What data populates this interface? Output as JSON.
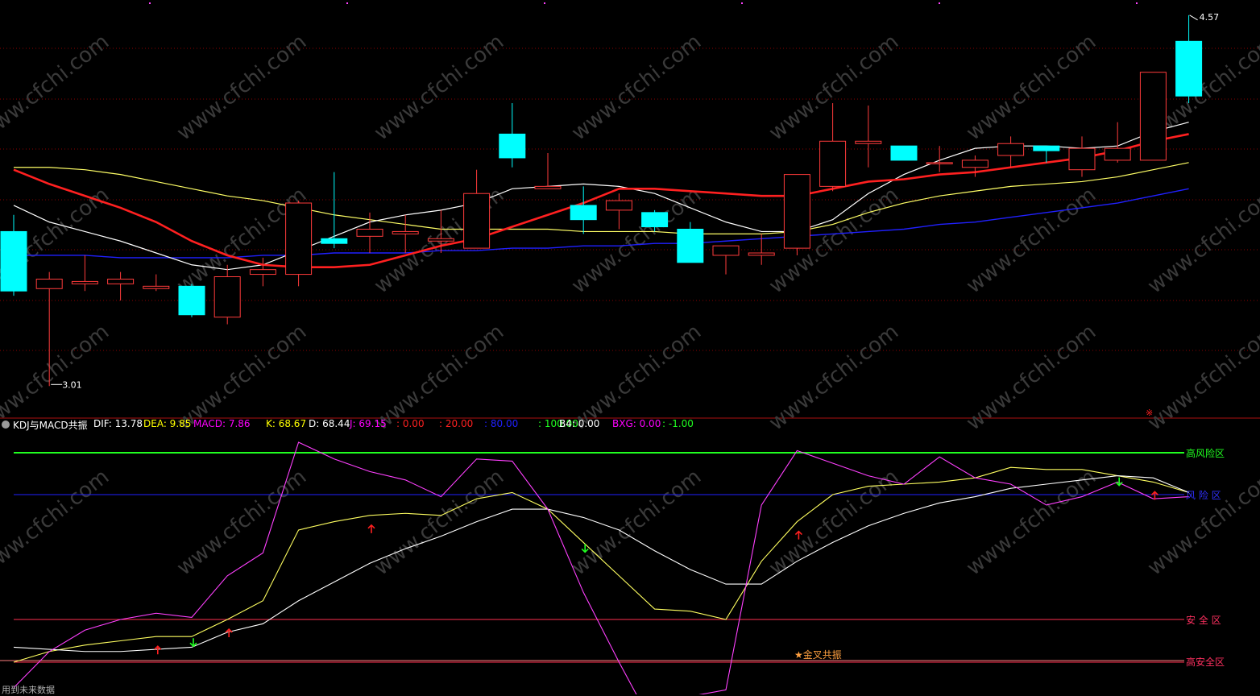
{
  "indicator": {
    "name": "KDJ与MACD共振",
    "values": [
      {
        "label": "DIF: 13.78",
        "color": "#ffffff"
      },
      {
        "label": "DEA: 9.85",
        "color": "#ffff00"
      },
      {
        "label": "MACD: 7.86",
        "color": "#ff00ff"
      },
      {
        "label": "K: 68.67",
        "color": "#ffff00"
      },
      {
        "label": "D: 68.44",
        "color": "#ffffff"
      },
      {
        "label": "J: 69.15",
        "color": "#ff00ff"
      },
      {
        "label": ": 0.00",
        "color": "#ff2020"
      },
      {
        "label": ": 20.00",
        "color": "#ff2020"
      },
      {
        "label": ": 80.00",
        "color": "#2020ff"
      },
      {
        "label": ": 100.00",
        "color": "#20ff20"
      },
      {
        "label": "B4: 0.00",
        "color": "#ffffff"
      },
      {
        "label": "BXG: 0.00",
        "color": "#ff00ff"
      },
      {
        "label": ": -1.00",
        "color": "#20ff20"
      }
    ]
  },
  "zones": {
    "high_risk": "高风险区",
    "risk": "风 险 区",
    "safe": "安 全 区",
    "high_safe": "高安全区"
  },
  "annotation": "★金叉共振",
  "footer": "用到未来数据",
  "price_high_label": "4.57",
  "price_low_label": "3.01",
  "watermark": "www.cfchi.com",
  "colors": {
    "up": "#ff3b3b",
    "down": "#00ffff",
    "ma_fast": "#ffffff",
    "ma_mid": "#ff2020",
    "ma_slow": "#ffff66",
    "ma_long": "#2020ff",
    "grid": "#8b0000"
  },
  "chart_data": [
    {
      "type": "candlestick",
      "ylim": [
        2.95,
        4.6
      ],
      "candles": [
        {
          "o": 3.66,
          "c": 3.41,
          "h": 3.73,
          "l": 3.39
        },
        {
          "o": 3.42,
          "c": 3.46,
          "h": 3.49,
          "l": 3.01
        },
        {
          "o": 3.44,
          "c": 3.45,
          "h": 3.56,
          "l": 3.41
        },
        {
          "o": 3.44,
          "c": 3.46,
          "h": 3.49,
          "l": 3.37
        },
        {
          "o": 3.42,
          "c": 3.43,
          "h": 3.48,
          "l": 3.41
        },
        {
          "o": 3.43,
          "c": 3.31,
          "h": 3.44,
          "l": 3.3
        },
        {
          "o": 3.3,
          "c": 3.47,
          "h": 3.52,
          "l": 3.27
        },
        {
          "o": 3.48,
          "c": 3.5,
          "h": 3.55,
          "l": 3.43
        },
        {
          "o": 3.48,
          "c": 3.78,
          "h": 3.79,
          "l": 3.43
        },
        {
          "o": 3.63,
          "c": 3.61,
          "h": 3.91,
          "l": 3.59
        },
        {
          "o": 3.64,
          "c": 3.67,
          "h": 3.74,
          "l": 3.57
        },
        {
          "o": 3.65,
          "c": 3.66,
          "h": 3.73,
          "l": 3.57
        },
        {
          "o": 3.62,
          "c": 3.63,
          "h": 3.75,
          "l": 3.57
        },
        {
          "o": 3.59,
          "c": 3.82,
          "h": 3.92,
          "l": 3.59
        },
        {
          "o": 4.07,
          "c": 3.97,
          "h": 4.2,
          "l": 3.93
        },
        {
          "o": 3.84,
          "c": 3.85,
          "h": 3.99,
          "l": 3.84
        },
        {
          "o": 3.77,
          "c": 3.71,
          "h": 3.85,
          "l": 3.65
        },
        {
          "o": 3.75,
          "c": 3.79,
          "h": 3.82,
          "l": 3.67
        },
        {
          "o": 3.74,
          "c": 3.68,
          "h": 3.75,
          "l": 3.66
        },
        {
          "o": 3.67,
          "c": 3.53,
          "h": 3.7,
          "l": 3.53
        },
        {
          "o": 3.56,
          "c": 3.6,
          "h": 3.6,
          "l": 3.48
        },
        {
          "o": 3.56,
          "c": 3.57,
          "h": 3.65,
          "l": 3.52
        },
        {
          "o": 3.59,
          "c": 3.9,
          "h": 3.9,
          "l": 3.56
        },
        {
          "o": 3.85,
          "c": 4.04,
          "h": 4.2,
          "l": 3.83
        },
        {
          "o": 4.03,
          "c": 4.04,
          "h": 4.19,
          "l": 3.93
        },
        {
          "o": 4.02,
          "c": 3.96,
          "h": 4.02,
          "l": 3.96
        },
        {
          "o": 3.95,
          "c": 3.95,
          "h": 4.02,
          "l": 3.91
        },
        {
          "o": 3.93,
          "c": 3.96,
          "h": 3.98,
          "l": 3.89
        },
        {
          "o": 3.98,
          "c": 4.03,
          "h": 4.06,
          "l": 3.93
        },
        {
          "o": 4.02,
          "c": 4.0,
          "h": 4.02,
          "l": 3.95
        },
        {
          "o": 3.92,
          "c": 4.01,
          "h": 4.06,
          "l": 3.89
        },
        {
          "o": 3.96,
          "c": 4.01,
          "h": 4.12,
          "l": 3.95
        },
        {
          "o": 3.96,
          "c": 4.33,
          "h": 4.33,
          "l": 3.96
        },
        {
          "o": 4.46,
          "c": 4.23,
          "h": 4.57,
          "l": 4.2
        }
      ],
      "ma_fast": [
        3.77,
        3.7,
        3.66,
        3.62,
        3.57,
        3.52,
        3.5,
        3.52,
        3.58,
        3.64,
        3.7,
        3.73,
        3.75,
        3.78,
        3.84,
        3.85,
        3.86,
        3.85,
        3.82,
        3.76,
        3.7,
        3.66,
        3.66,
        3.71,
        3.82,
        3.9,
        3.96,
        4.01,
        4.02,
        4.02,
        4.01,
        4.02,
        4.08,
        4.12
      ],
      "ma_mid": [
        3.92,
        3.86,
        3.81,
        3.76,
        3.7,
        3.62,
        3.56,
        3.52,
        3.51,
        3.51,
        3.52,
        3.56,
        3.6,
        3.63,
        3.68,
        3.73,
        3.78,
        3.84,
        3.84,
        3.83,
        3.82,
        3.81,
        3.81,
        3.84,
        3.87,
        3.88,
        3.9,
        3.91,
        3.93,
        3.95,
        3.97,
        4.0,
        4.04,
        4.07
      ],
      "ma_slow": [
        3.93,
        3.93,
        3.92,
        3.9,
        3.87,
        3.84,
        3.81,
        3.79,
        3.76,
        3.73,
        3.71,
        3.69,
        3.67,
        3.67,
        3.67,
        3.67,
        3.66,
        3.66,
        3.66,
        3.65,
        3.65,
        3.65,
        3.66,
        3.69,
        3.74,
        3.78,
        3.81,
        3.83,
        3.85,
        3.86,
        3.87,
        3.89,
        3.92,
        3.95
      ],
      "ma_long": [
        3.56,
        3.56,
        3.56,
        3.55,
        3.55,
        3.55,
        3.55,
        3.56,
        3.56,
        3.57,
        3.57,
        3.57,
        3.58,
        3.58,
        3.59,
        3.59,
        3.6,
        3.6,
        3.61,
        3.61,
        3.62,
        3.63,
        3.64,
        3.65,
        3.66,
        3.67,
        3.69,
        3.7,
        3.72,
        3.74,
        3.76,
        3.78,
        3.81,
        3.84
      ]
    },
    {
      "type": "line",
      "ylim": [
        -15,
        105
      ],
      "series": [
        {
          "name": "K",
          "values": [
            0,
            5,
            8,
            10,
            12,
            12,
            20,
            29,
            63,
            67,
            70,
            71,
            70,
            78,
            81,
            73,
            57,
            41,
            25,
            24,
            20,
            48,
            67,
            80,
            84,
            85,
            86,
            88,
            93,
            92,
            92,
            89,
            86,
            81
          ]
        },
        {
          "name": "D",
          "values": [
            7,
            6,
            5,
            5,
            6,
            7,
            14,
            18,
            29,
            38,
            47,
            54,
            60,
            67,
            73,
            73,
            69,
            63,
            53,
            44,
            37,
            37,
            48,
            57,
            65,
            71,
            76,
            79,
            83,
            85,
            87,
            89,
            88,
            81
          ]
        },
        {
          "name": "J",
          "values": [
            -12,
            5,
            15,
            20,
            23,
            21,
            41,
            52,
            105,
            97,
            91,
            87,
            79,
            97,
            96,
            73,
            33,
            0,
            -31,
            -16,
            -13,
            75,
            101,
            95,
            89,
            85,
            98,
            88,
            85,
            75,
            79,
            86,
            78,
            79
          ]
        }
      ],
      "gold_cross_marks": [
        4,
        6,
        10,
        22,
        32
      ],
      "dead_cross_marks": [
        5,
        16,
        31
      ],
      "levels": [
        0,
        20,
        80,
        100
      ]
    }
  ]
}
